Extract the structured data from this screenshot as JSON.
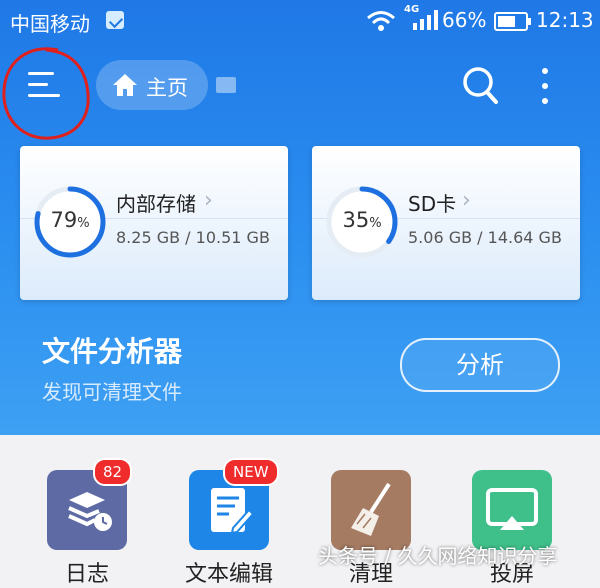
{
  "status_bar": {
    "carrier": "中国移动",
    "network": "4G",
    "battery": "66%",
    "battery_level": 0.66,
    "time": "12:13"
  },
  "toolbar": {
    "home_label": "主页"
  },
  "storage": [
    {
      "title": "内部存储",
      "percent": "79",
      "percent_unit": "%",
      "usage": 0.79,
      "sizes": "8.25 GB / 10.51 GB"
    },
    {
      "title": "SD卡",
      "percent": "35",
      "percent_unit": "%",
      "usage": 0.35,
      "sizes": "5.06 GB / 14.64 GB"
    }
  ],
  "analyzer": {
    "title": "文件分析器",
    "subtitle": "发现可清理文件",
    "button": "分析"
  },
  "tools": [
    {
      "name": "日志",
      "badge": "82",
      "icon": "log-icon"
    },
    {
      "name": "文本编辑",
      "badge": "NEW",
      "icon": "text-edit-icon"
    },
    {
      "name": "清理",
      "icon": "broom-icon"
    },
    {
      "name": "投屏",
      "icon": "cast-icon"
    }
  ],
  "watermark": "头条号 / 久久网络知识分享",
  "colors": {
    "primary": "#1f78e6",
    "accent_ring": "#1e6fe0",
    "badge_red": "#ef2b2b",
    "annotation_red": "#e0201c"
  }
}
